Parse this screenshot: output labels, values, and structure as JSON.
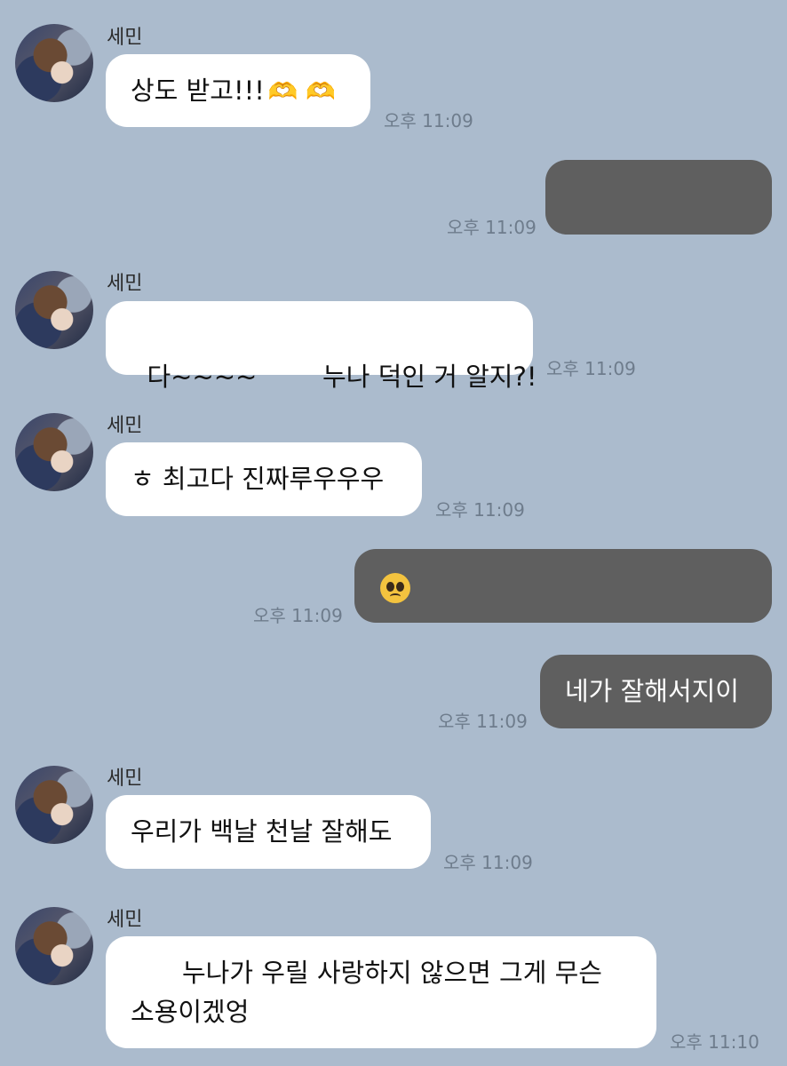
{
  "contact": {
    "name": "세민"
  },
  "messages": [
    {
      "id": "m1",
      "side": "in",
      "sender": "세민",
      "text": "상도 받고!!!",
      "emoji": "🫶 🫶",
      "time": "오후 11:09"
    },
    {
      "id": "m2",
      "side": "out",
      "text": "",
      "time": "오후 11:09"
    },
    {
      "id": "m3",
      "side": "in",
      "sender": "세민",
      "text": "다~~~~        누나 덕인 거 알지?!",
      "time": "오후 11:09"
    },
    {
      "id": "m4",
      "side": "in",
      "sender": "세민",
      "text": "ㅎ 최고다 진짜루우우우",
      "time": "오후 11:09"
    },
    {
      "id": "m5",
      "side": "out",
      "emoji": "pleading-face",
      "time": "오후 11:09"
    },
    {
      "id": "m6",
      "side": "out",
      "text": "네가 잘해서지이",
      "time": "오후 11:09"
    },
    {
      "id": "m7",
      "side": "in",
      "sender": "세민",
      "text": "우리가 백날 천날 잘해도",
      "time": "오후 11:09"
    },
    {
      "id": "m8",
      "side": "in",
      "sender": "세민",
      "line1": "누나가 우릴 사랑하지 않으면 그게 무슨",
      "line2": "소용이겠엉",
      "time": "오후 11:10"
    }
  ],
  "colors": {
    "background": "#abbbcd",
    "incoming": "#ffffff",
    "outgoing": "#5f5f5f"
  }
}
